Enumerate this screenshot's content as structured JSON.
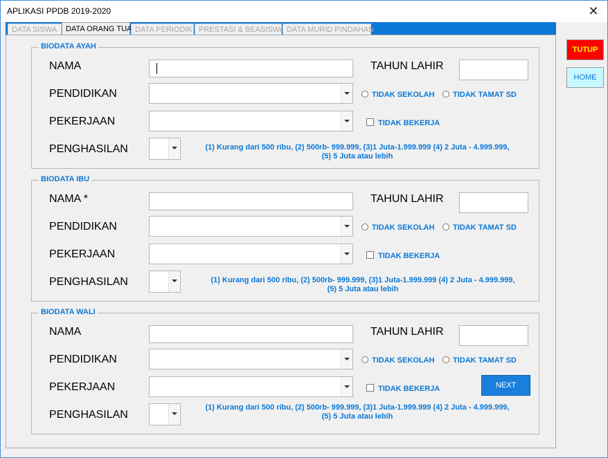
{
  "window": {
    "title": "APLIKASI PPDB 2019-2020",
    "close_label": "✕"
  },
  "tabs": [
    {
      "label": "DATA SISWA",
      "active": false
    },
    {
      "label": "DATA ORANG TUA",
      "active": true
    },
    {
      "label": "DATA PERIODIK",
      "active": false
    },
    {
      "label": "PRESTASI & BEASISWA",
      "active": false
    },
    {
      "label": "DATA MURID PINDAHAN",
      "active": false
    }
  ],
  "side_buttons": {
    "tutup": "TUTUP",
    "home": "HOME"
  },
  "next_button": "NEXT",
  "groups": {
    "ayah": {
      "title": "BIODATA AYAH",
      "nama_label": "NAMA",
      "tahun_label": "TAHUN LAHIR",
      "pendidikan_label": "PENDIDIKAN",
      "pekerjaan_label": "PEKERJAAN",
      "penghasilan_label": "PENGHASILAN",
      "opt_tidak_sekolah": "TIDAK SEKOLAH",
      "opt_tidak_tamat_sd": "TIDAK TAMAT SD",
      "opt_tidak_bekerja": "TIDAK BEKERJA",
      "note_line1": "(1) Kurang dari 500 ribu, (2) 500rb- 999.999, (3)1 Juta-1.999.999 (4) 2 Juta - 4.999.999,",
      "note_line2": "(5) 5 Juta atau lebih"
    },
    "ibu": {
      "title": "BIODATA IBU",
      "nama_label": "NAMA *",
      "tahun_label": "TAHUN LAHIR",
      "pendidikan_label": "PENDIDIKAN",
      "pekerjaan_label": "PEKERJAAN",
      "penghasilan_label": "PENGHASILAN",
      "opt_tidak_sekolah": "TIDAK SEKOLAH",
      "opt_tidak_tamat_sd": "TIDAK TAMAT SD",
      "opt_tidak_bekerja": "TIDAK BEKERJA",
      "note_line1": "(1) Kurang dari 500 ribu, (2) 500rb- 999.999, (3)1 Juta-1.999.999 (4) 2 Juta - 4.999.999,",
      "note_line2": "(5) 5 Juta atau lebih"
    },
    "wali": {
      "title": "BIODATA WALI",
      "nama_label": "NAMA",
      "tahun_label": "TAHUN LAHIR",
      "pendidikan_label": "PENDIDIKAN",
      "pekerjaan_label": "PEKERJAAN",
      "penghasilan_label": "PENGHASILAN",
      "opt_tidak_sekolah": "TIDAK SEKOLAH",
      "opt_tidak_tamat_sd": "TIDAK TAMAT SD",
      "opt_tidak_bekerja": "TIDAK BEKERJA",
      "note_line1": "(1) Kurang dari 500 ribu, (2) 500rb- 999.999, (3)1 Juta-1.999.999 (4) 2 Juta - 4.999.999,",
      "note_line2": "(5) 5 Juta atau lebih"
    }
  },
  "colors": {
    "accent": "#0a78d7",
    "tutup_bg": "#ff0000",
    "tutup_text": "#ffff00",
    "home_bg": "#c8f8ff",
    "next_bg": "#1a7fdc"
  }
}
